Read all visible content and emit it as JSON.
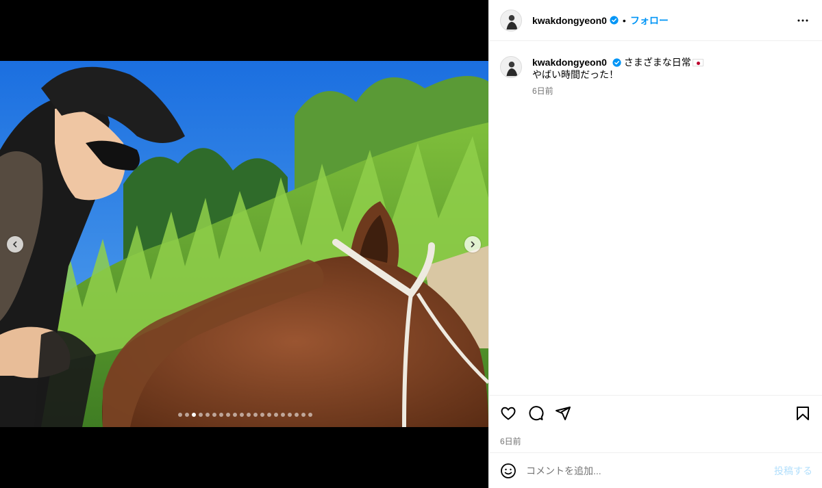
{
  "post": {
    "username": "kwakdongyeon0",
    "follow_label": "フォロー",
    "separator": "•",
    "caption_line1": "さまざまな日常",
    "caption_line2": "やばい時間だった！",
    "caption_time": "6日前",
    "post_time": "6日前",
    "comment_placeholder": "コメントを追加...",
    "post_button": "投稿する"
  },
  "carousel": {
    "total_slides": 20,
    "active_slide": 3
  },
  "icons": {
    "verified": "verified-badge-icon",
    "more": "more-options-icon",
    "like": "heart-icon",
    "comment": "comment-icon",
    "share": "share-icon",
    "save": "bookmark-icon",
    "emoji": "emoji-icon",
    "prev": "chevron-left-icon",
    "next": "chevron-right-icon"
  },
  "colors": {
    "accent": "#0095f6",
    "verified": "#0095f6",
    "muted": "#737373",
    "post_disabled": "#b2dffc"
  }
}
